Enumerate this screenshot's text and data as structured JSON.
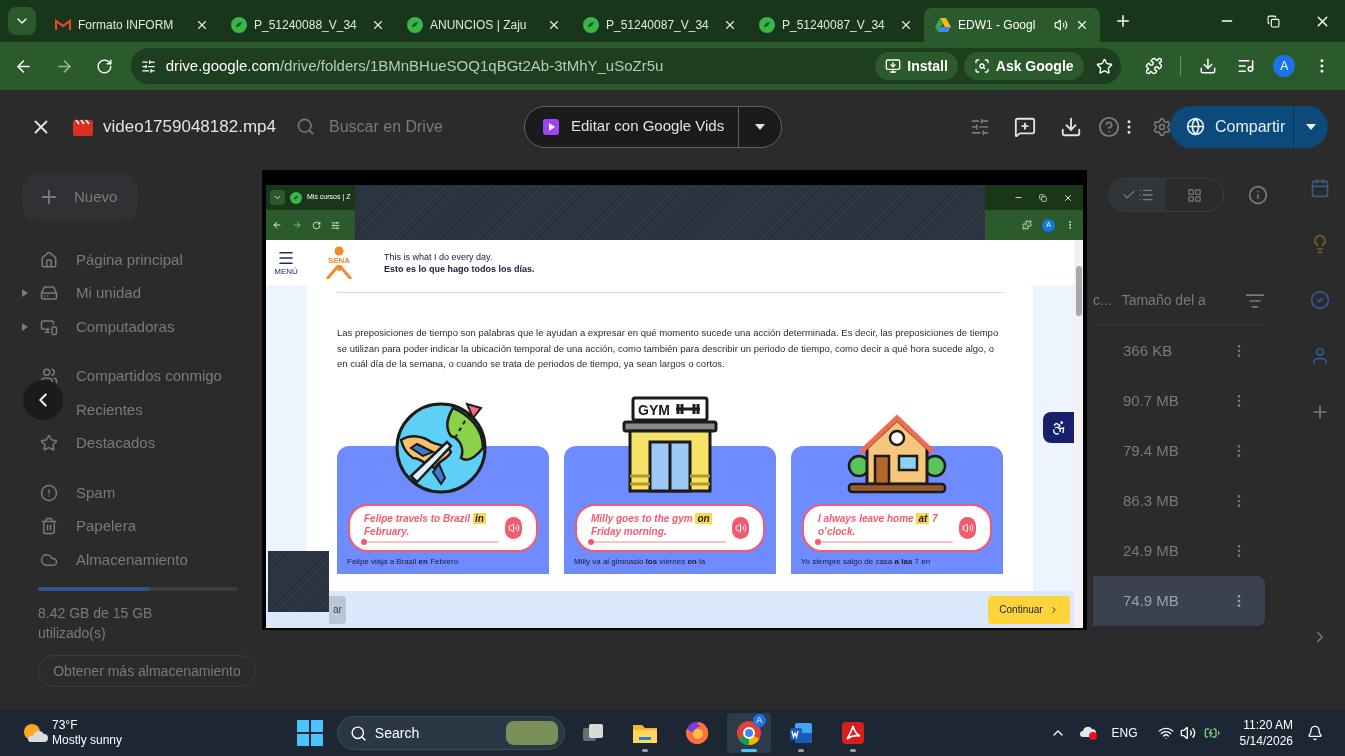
{
  "browser": {
    "tabs": [
      {
        "title": "Formato INFORM",
        "kind": "mail",
        "selected": false,
        "audio": false
      },
      {
        "title": "P_51240088_V_34",
        "kind": "leaf",
        "selected": false,
        "audio": false
      },
      {
        "title": "ANUNCIOS | Zaju",
        "kind": "leaf",
        "selected": false,
        "audio": false
      },
      {
        "title": "P_51240087_V_34",
        "kind": "leaf",
        "selected": false,
        "audio": false
      },
      {
        "title": "P_51240087_V_34",
        "kind": "leaf",
        "selected": false,
        "audio": false
      },
      {
        "title": "EDW1 - Googl",
        "kind": "triangle",
        "selected": true,
        "audio": true
      }
    ],
    "address": {
      "host": "drive.google.com",
      "path": "/drive/folders/1BMnBHueSOQ1qBGt2Ab-3tMhY_uSoZr5u"
    },
    "chips": [
      "Install",
      "Ask Google"
    ],
    "profile": "A"
  },
  "drive": {
    "new_button": "Nuevo",
    "nav": [
      [
        {
          "label": "Página principal",
          "caret": false,
          "kind": "home"
        },
        {
          "label": "Mi unidad",
          "caret": true,
          "kind": "drive"
        },
        {
          "label": "Computadoras",
          "caret": true,
          "kind": "computer"
        }
      ],
      [
        {
          "label": "Compartidos conmigo",
          "caret": false,
          "kind": "shared"
        },
        {
          "label": "Recientes",
          "caret": false,
          "kind": "plain"
        },
        {
          "label": "Destacados",
          "caret": false,
          "kind": "star"
        }
      ],
      [
        {
          "label": "Spam",
          "caret": false,
          "kind": "spam"
        },
        {
          "label": "Papelera",
          "caret": false,
          "kind": "trash"
        },
        {
          "label": "Almacenamiento",
          "caret": false,
          "kind": "cloud"
        }
      ]
    ],
    "storage": {
      "level": 0.56,
      "text": "8.42 GB de 15 GB utilizado(s)",
      "button": "Obtener más almacenamiento"
    },
    "columns": [
      "c...",
      "Tamaño del a"
    ],
    "rows": [
      {
        "size": "366 KB",
        "selected": false
      },
      {
        "size": "90.7 MB",
        "selected": false
      },
      {
        "size": "79.4 MB",
        "selected": false
      },
      {
        "size": "86.3 MB",
        "selected": false
      },
      {
        "size": "24.9 MB",
        "selected": false
      },
      {
        "size": "74.9 MB",
        "selected": true
      }
    ]
  },
  "viewer": {
    "file_name": "video1759048182.mp4",
    "search_placeholder": "Buscar en Drive",
    "edit_button": "Editar con Google Vids",
    "share_button": "Compartir"
  },
  "video": {
    "tab_title": "Mis cursos | Z",
    "profile": "A",
    "menu_label": "MENÚ",
    "logo_text": "SENA",
    "title_en": "This is what I do every day.",
    "title_es": "Esto es lo que hago todos los días.",
    "paragraph": "Las preposiciones de tiempo son palabras que le ayudan a expresar en qué momento sucede una acción determinada. Es decir, las preposiciones de tiempo se utilizan para poder indicar la ubicación temporal de una acción, como también para describir un periodo de tiempo, como decir a qué hora sucede algo, o en cuál día de la semana, o cuando se trata de periodos de tiempo, ya sean largos o cortos.",
    "cards": [
      {
        "kind": "globe",
        "before": "Felipe travels to Brazil",
        "highlight": "in",
        "after": "February.",
        "level": 0,
        "translation": "Felipe viaja a Brasil **en** Febrero"
      },
      {
        "kind": "gym",
        "sign": "GYM",
        "before": "Milly goes to the gym",
        "highlight": "on",
        "after": "Friday morning.",
        "level": 0,
        "translation": "Milly va al gimnasio **los** viernes **en** la"
      },
      {
        "kind": "house",
        "before": "I always leave home",
        "highlight": "at",
        "after": "7 o’clock.",
        "level": 0,
        "translation": "Yo siempre salgo de casa **a las** 7 en"
      }
    ],
    "back_button": "ar",
    "continue_button": "Continuar"
  },
  "taskbar": {
    "temperature": "73°F",
    "weather": "Mostly sunny",
    "search": "Search",
    "apps": [
      {
        "kind": "taskview",
        "running": false,
        "selected": false
      },
      {
        "kind": "explorer",
        "running": true,
        "selected": false
      },
      {
        "kind": "firefox",
        "running": false,
        "selected": false
      },
      {
        "kind": "chrome",
        "running": true,
        "selected": true,
        "badge": "A"
      },
      {
        "kind": "word",
        "running": true,
        "selected": false
      },
      {
        "kind": "acrobat",
        "running": true,
        "selected": false
      }
    ],
    "language": "ENG",
    "time": "11:20 AM",
    "date": "5/14/2026"
  }
}
